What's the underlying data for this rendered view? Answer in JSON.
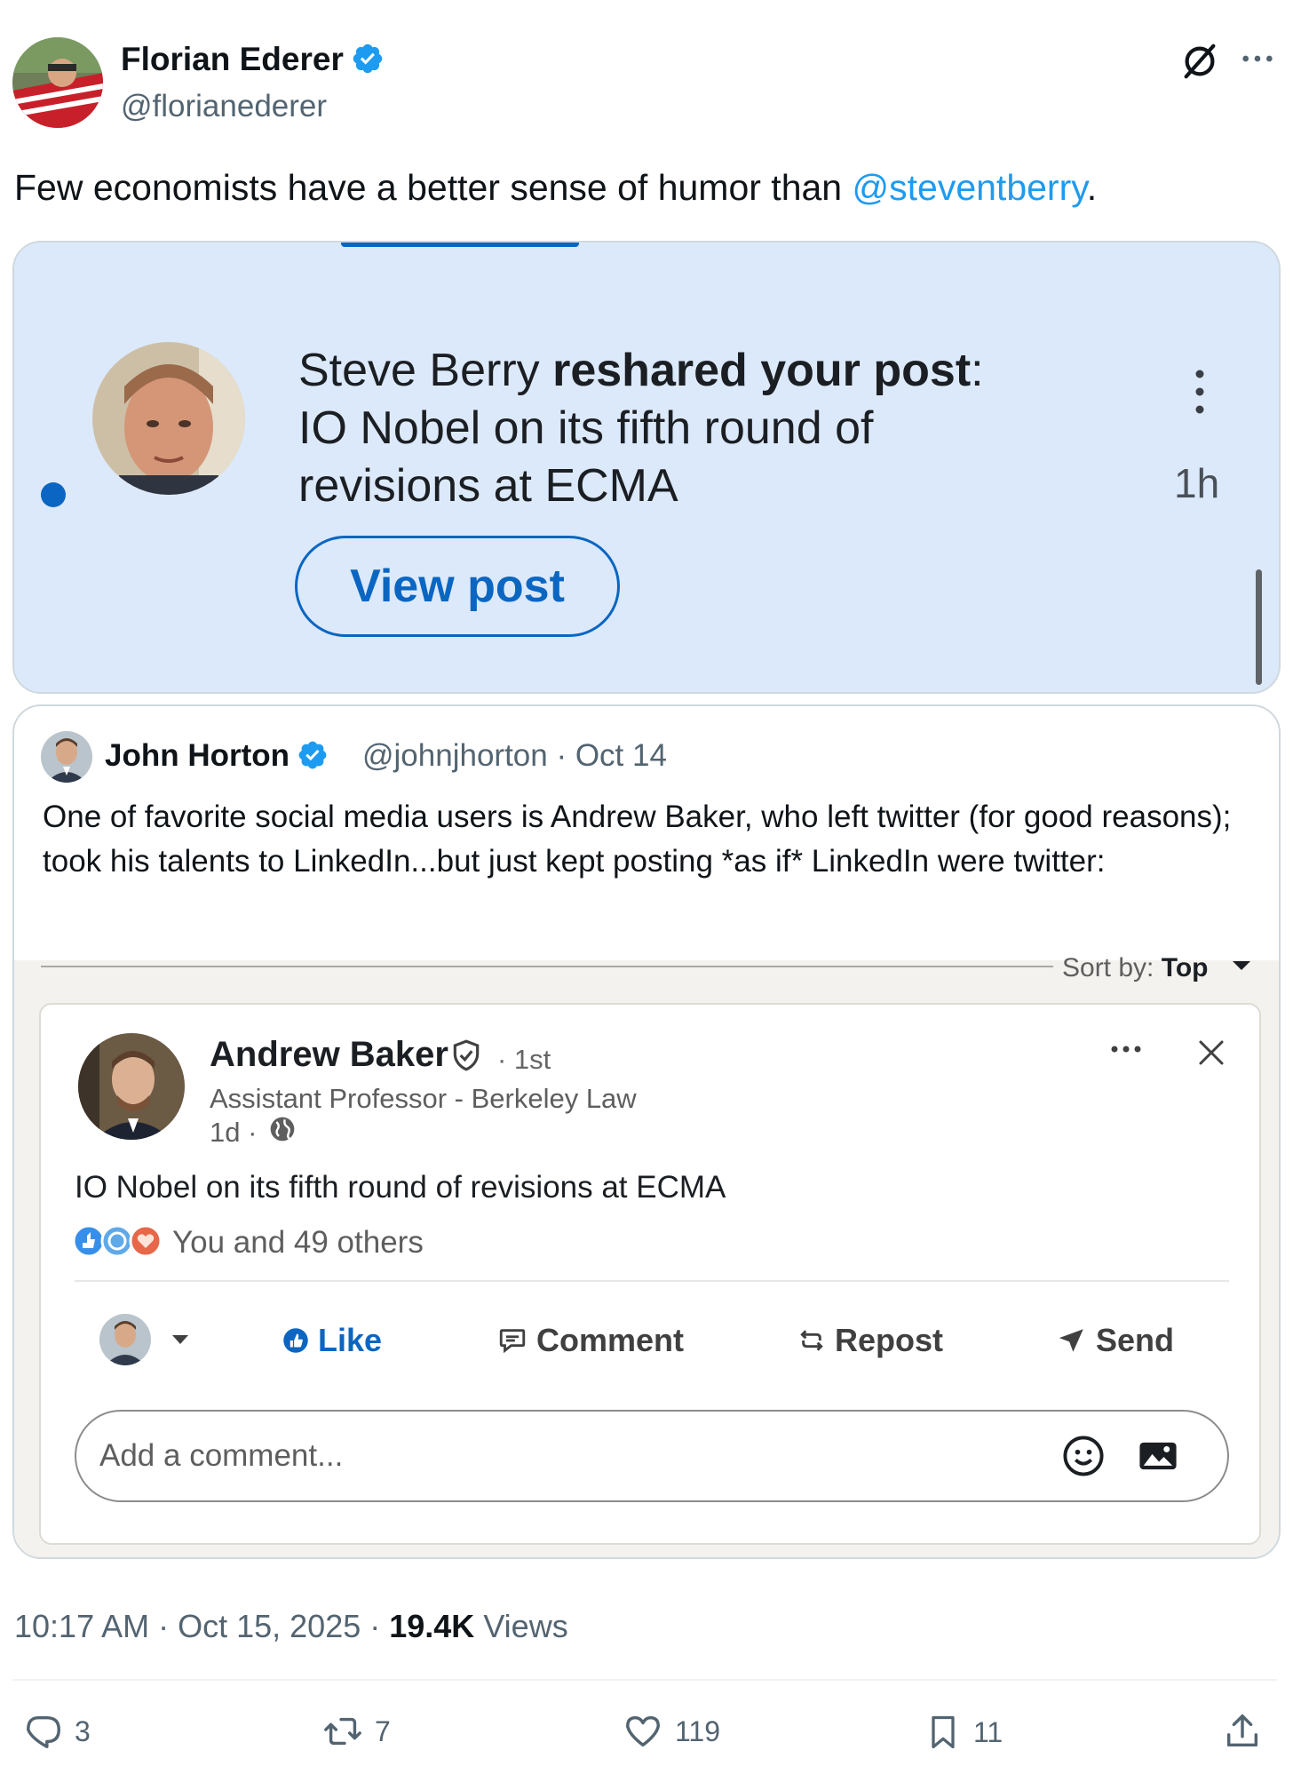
{
  "tweet": {
    "author_name": "Florian Ederer",
    "author_handle": "@florianederer",
    "text_before_mention": "Few economists have a better sense of humor than ",
    "mention": "@steventberry",
    "text_after_mention": ".",
    "timestamp": "10:17 AM · Oct 15, 2025 · ",
    "views_count": "19.4K",
    "views_label": " Views"
  },
  "media": {
    "actor": "Steve Berry",
    "action": "reshared your post",
    "action_suffix": ":",
    "post_title": "IO Nobel on its fifth round of revisions at ECMA",
    "time": "1h",
    "button_label": "View post"
  },
  "quote": {
    "author_name": "John Horton",
    "handle_and_date": "@johnjhorton · Oct 14",
    "text": "One of favorite social media users is Andrew Baker, who left twitter (for good reasons); took his talents to LinkedIn...but just kept posting *as if* LinkedIn were twitter:"
  },
  "linkedin": {
    "sort_label": "Sort by: ",
    "sort_value": "Top",
    "author_name": "Andrew Baker",
    "degree": "· 1st",
    "headline": "Assistant Professor - Berkeley Law",
    "time": "1d ·",
    "post_text": "IO Nobel on its fifth round of revisions at ECMA",
    "reactions_text": "You and 49 others",
    "actions": {
      "like": "Like",
      "comment": "Comment",
      "repost": "Repost",
      "send": "Send"
    },
    "comment_placeholder": "Add a comment..."
  },
  "actions": {
    "replies": "3",
    "reposts": "7",
    "likes": "119",
    "bookmarks": "11"
  },
  "colors": {
    "link": "#1d9bf0",
    "linkedin_blue": "#0a66c2",
    "notification_bg": "#dce9fa",
    "muted": "#536471"
  }
}
